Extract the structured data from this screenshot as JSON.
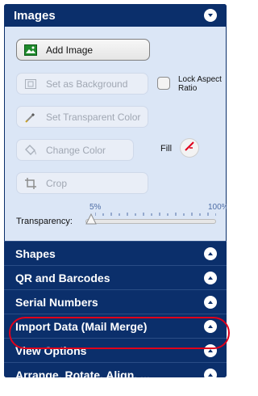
{
  "images_panel": {
    "title": "Images",
    "buttons": {
      "add_image": "Add Image",
      "set_background": "Set as Background",
      "set_transparent": "Set Transparent Color",
      "change_color": "Change Color",
      "crop": "Crop"
    },
    "lock_aspect_ratio": {
      "line1": "Lock Aspect",
      "line2": "Ratio",
      "checked": false
    },
    "fill_label": "Fill",
    "transparency": {
      "label": "Transparency:",
      "min_label": "5%",
      "max_label": "100%",
      "value_percent": 5
    }
  },
  "sections": [
    {
      "label": "Shapes"
    },
    {
      "label": "QR and Barcodes"
    },
    {
      "label": "Serial Numbers"
    },
    {
      "label": "Import Data (Mail Merge)"
    },
    {
      "label": "View Options"
    },
    {
      "label": "Arrange, Rotate, Align, ..."
    }
  ],
  "colors": {
    "panel_bg": "#0b2f6b",
    "body_bg": "#dbe6f6",
    "highlight": "#e0001b"
  }
}
